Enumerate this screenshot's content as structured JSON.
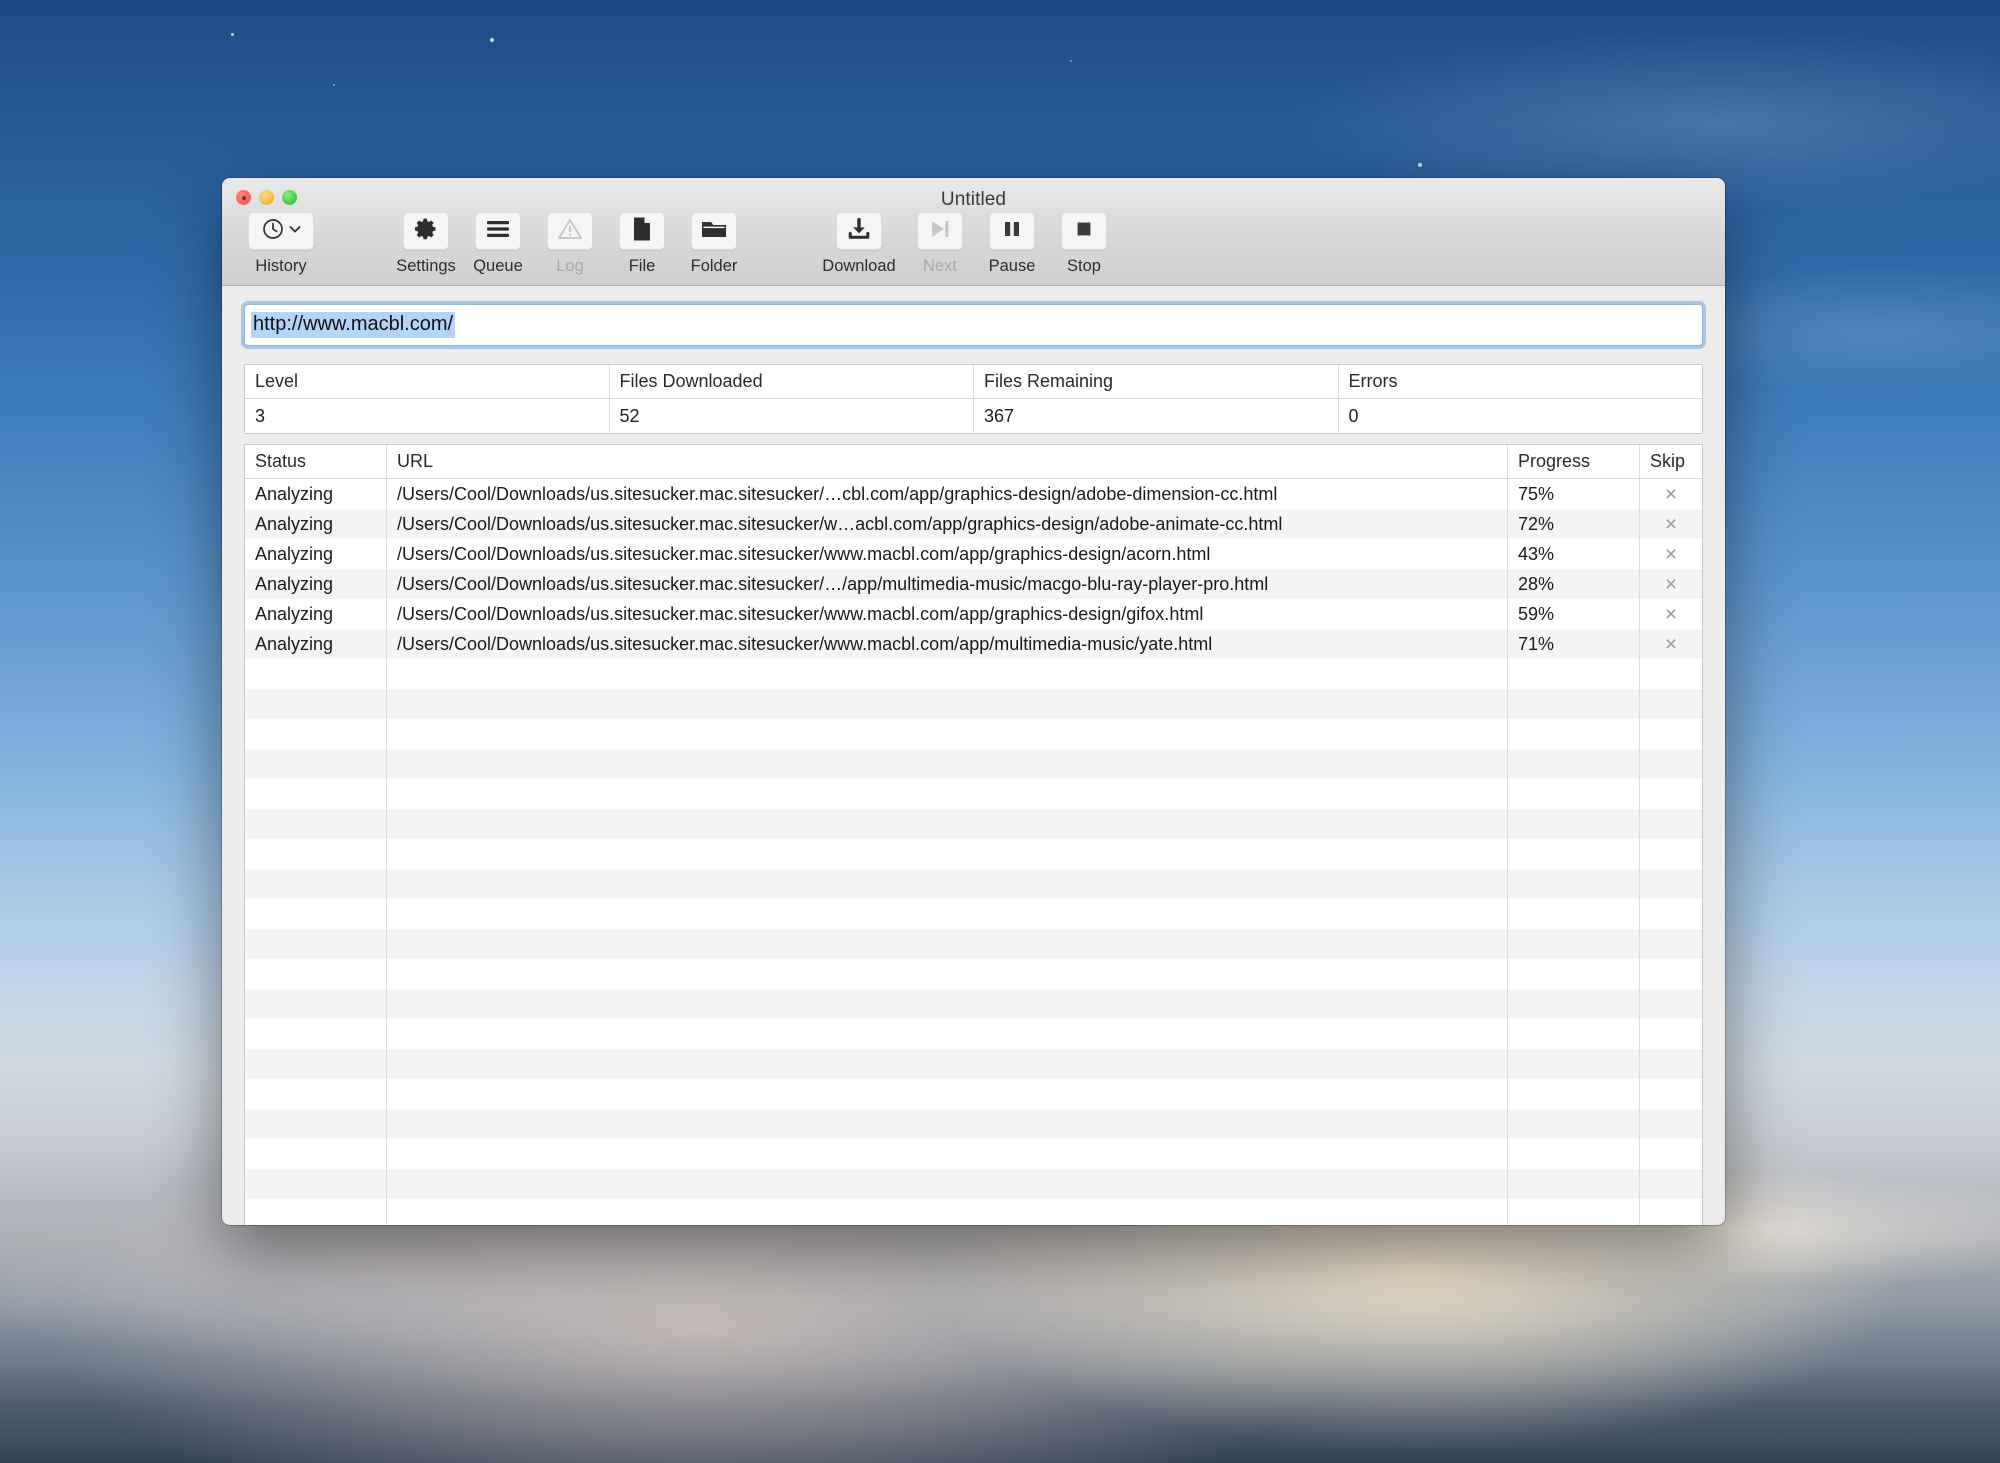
{
  "window": {
    "title": "Untitled",
    "traffic_lights": [
      "close-red",
      "minimize-amber",
      "maximize-green"
    ]
  },
  "toolbar": {
    "items": [
      {
        "label": "History",
        "icon": "clock-history-icon",
        "disabled": false,
        "has_menu": true
      },
      {
        "label": "Settings",
        "icon": "gear-icon",
        "disabled": false
      },
      {
        "label": "Queue",
        "icon": "list-lines-icon",
        "disabled": false
      },
      {
        "label": "Log",
        "icon": "warning-triangle-icon",
        "disabled": true
      },
      {
        "label": "File",
        "icon": "document-page-icon",
        "disabled": false
      },
      {
        "label": "Folder",
        "icon": "folder-icon",
        "disabled": false
      },
      {
        "label": "Download",
        "icon": "download-arrow-icon",
        "disabled": false
      },
      {
        "label": "Next",
        "icon": "skip-next-icon",
        "disabled": true
      },
      {
        "label": "Pause",
        "icon": "pause-icon",
        "disabled": false
      },
      {
        "label": "Stop",
        "icon": "stop-square-icon",
        "disabled": false
      }
    ]
  },
  "url_bar": {
    "value": "http://www.macbl.com/",
    "placeholder": "Enter URL",
    "selected": true,
    "selection_color": "#b3d4f5",
    "focus_ring_color": "#6eaae6"
  },
  "stats": {
    "headers": [
      "Level",
      "Files Downloaded",
      "Files Remaining",
      "Errors"
    ],
    "values": [
      "3",
      "52",
      "367",
      "0"
    ]
  },
  "table": {
    "headers": [
      "Status",
      "URL",
      "Progress",
      "Skip"
    ],
    "skip_icon": "close-x-icon",
    "rows": [
      {
        "status": "Analyzing",
        "url": "/Users/Cool/Downloads/us.sitesucker.mac.sitesucker/…cbl.com/app/graphics-design/adobe-dimension-cc.html",
        "progress": "75%",
        "skip": "×"
      },
      {
        "status": "Analyzing",
        "url": "/Users/Cool/Downloads/us.sitesucker.mac.sitesucker/w…acbl.com/app/graphics-design/adobe-animate-cc.html",
        "progress": "72%",
        "skip": "×"
      },
      {
        "status": "Analyzing",
        "url": "/Users/Cool/Downloads/us.sitesucker.mac.sitesucker/www.macbl.com/app/graphics-design/acorn.html",
        "progress": "43%",
        "skip": "×"
      },
      {
        "status": "Analyzing",
        "url": "/Users/Cool/Downloads/us.sitesucker.mac.sitesucker/…/app/multimedia-music/macgo-blu-ray-player-pro.html",
        "progress": "28%",
        "skip": "×"
      },
      {
        "status": "Analyzing",
        "url": "/Users/Cool/Downloads/us.sitesucker.mac.sitesucker/www.macbl.com/app/graphics-design/gifox.html",
        "progress": "59%",
        "skip": "×"
      },
      {
        "status": "Analyzing",
        "url": "/Users/Cool/Downloads/us.sitesucker.mac.sitesucker/www.macbl.com/app/multimedia-music/yate.html",
        "progress": "71%",
        "skip": "×"
      }
    ],
    "empty_row_count": 22
  }
}
